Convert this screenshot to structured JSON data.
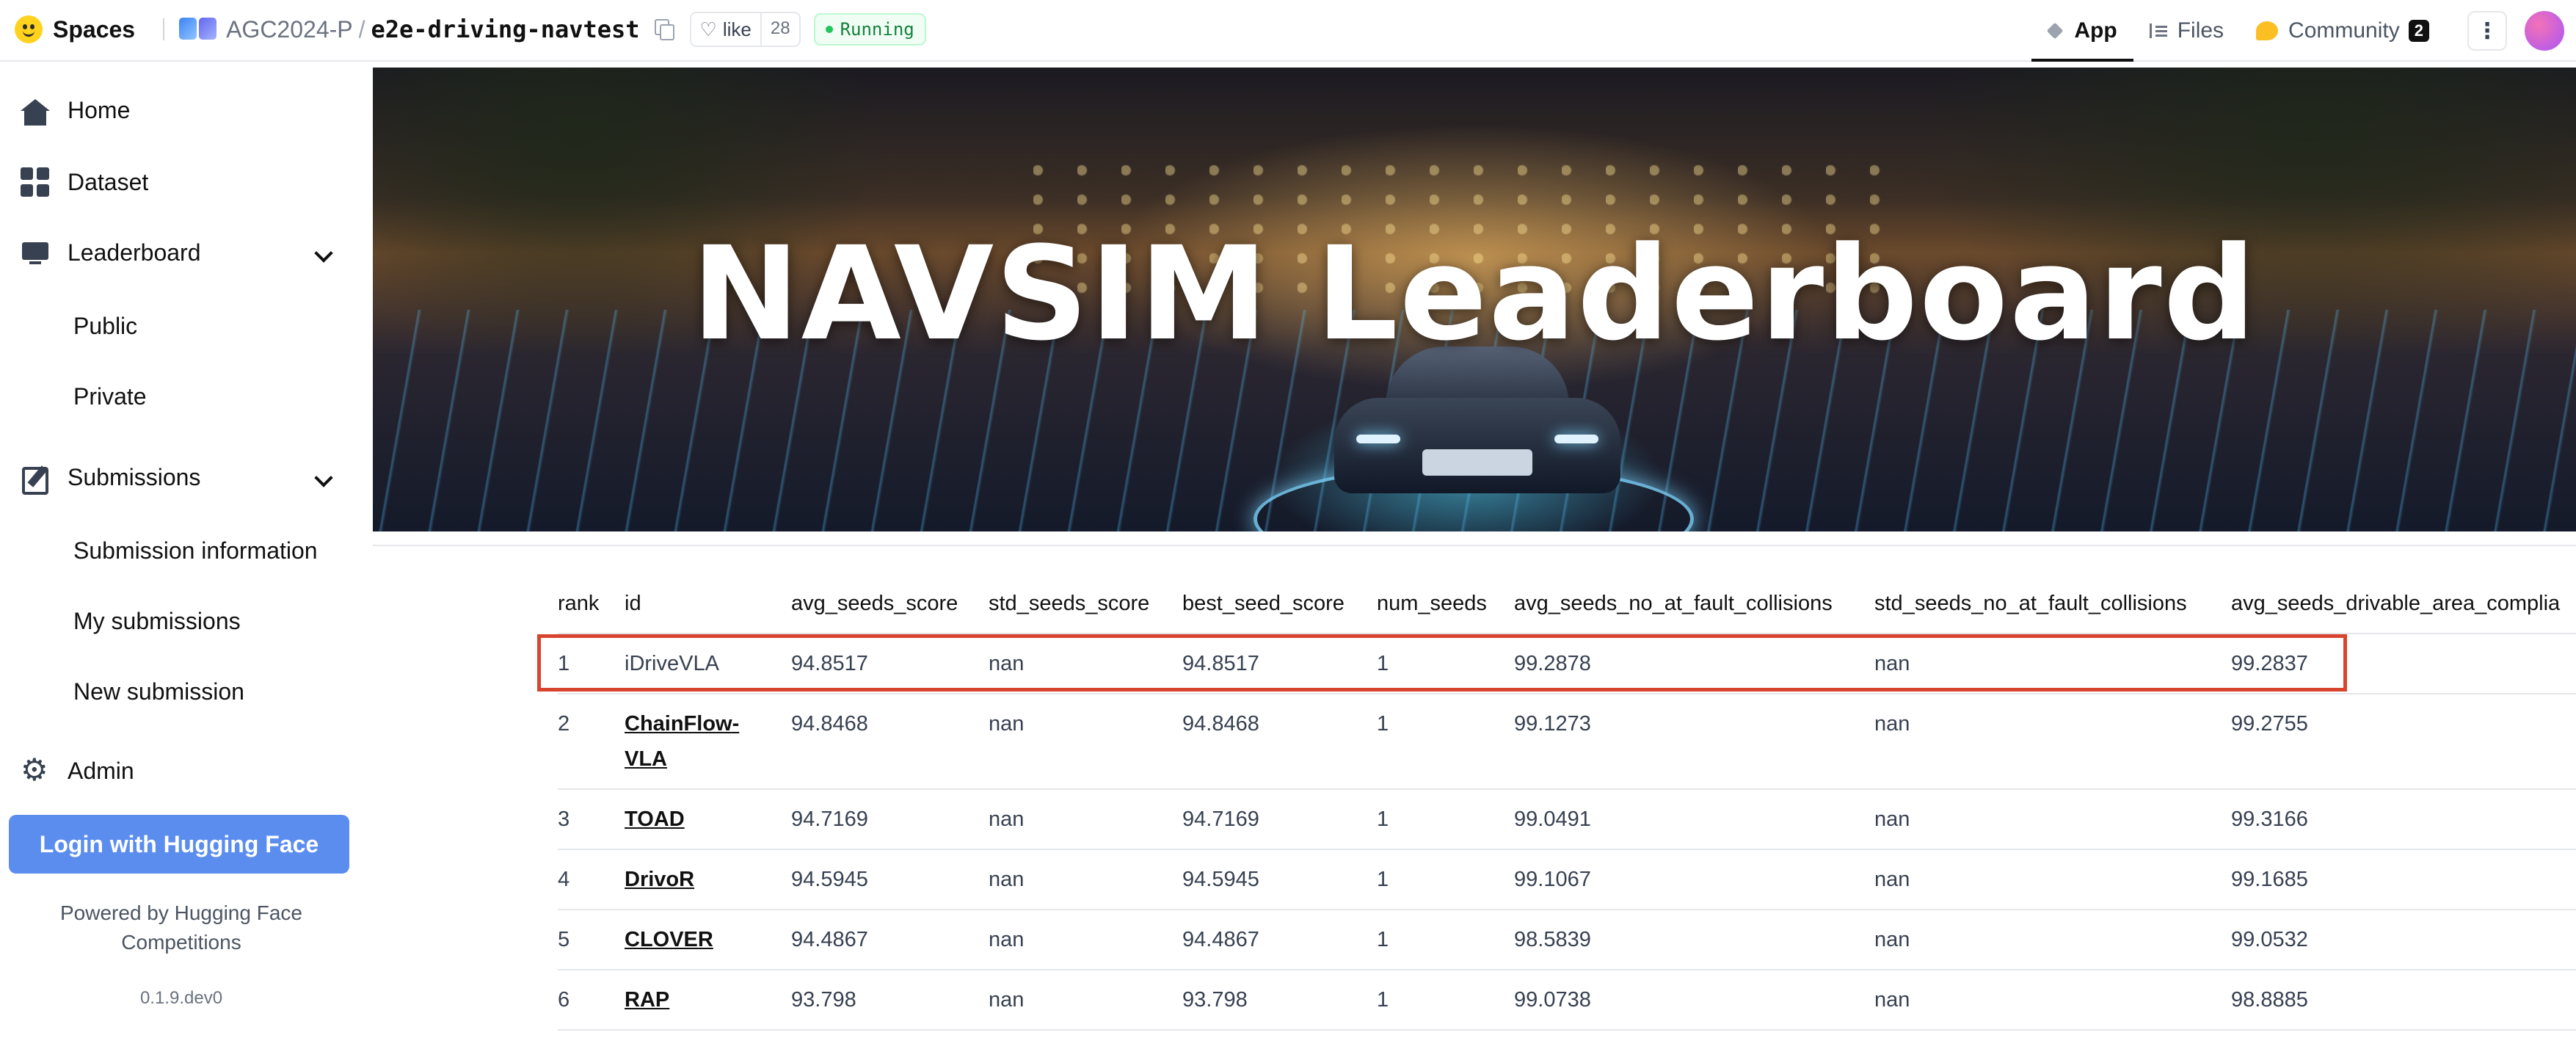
{
  "topbar": {
    "brand": "Spaces",
    "org": "AGC2024-P",
    "separator": "/",
    "repo": "e2e-driving-navtest",
    "like_label": "like",
    "like_count": "28",
    "status": "Running",
    "tabs": [
      {
        "label": "App",
        "icon": "cube-icon",
        "active": true
      },
      {
        "label": "Files",
        "icon": "files-icon",
        "active": false
      },
      {
        "label": "Community",
        "icon": "community-icon",
        "active": false,
        "badge": "2"
      }
    ],
    "menu_glyph": "⋮"
  },
  "sidebar": {
    "items": [
      {
        "label": "Home",
        "icon": "home-icon"
      },
      {
        "label": "Dataset",
        "icon": "dataset-icon"
      },
      {
        "label": "Leaderboard",
        "icon": "leaderboard-icon",
        "expandable": true
      },
      {
        "label": "Public"
      },
      {
        "label": "Private"
      },
      {
        "label": "Submissions",
        "icon": "submissions-icon",
        "expandable": true
      },
      {
        "label": "Submission information"
      },
      {
        "label": "My submissions"
      },
      {
        "label": "New submission"
      },
      {
        "label": "Admin",
        "icon": "gear-icon"
      }
    ],
    "login_button": "Login with Hugging Face",
    "powered_by_line1": "Powered by Hugging Face",
    "powered_by_line2": "Competitions",
    "version": "0.1.9.dev0"
  },
  "banner": {
    "title": "NAVSIM Leaderboard"
  },
  "table": {
    "columns": [
      "rank",
      "id",
      "avg_seeds_score",
      "std_seeds_score",
      "best_seed_score",
      "num_seeds",
      "avg_seeds_no_at_fault_collisions",
      "std_seeds_no_at_fault_collisions",
      "avg_seeds_drivable_area_complia"
    ],
    "rows": [
      {
        "rank": "1",
        "id": "iDriveVLA",
        "id_line2": "",
        "avg": "94.8517",
        "std": "nan",
        "best": "94.8517",
        "num": "1",
        "nafc_avg": "99.2878",
        "nafc_std": "nan",
        "dac_avg": "99.2837",
        "highlighted": true
      },
      {
        "rank": "2",
        "id": "ChainFlow-",
        "id_line2": "VLA",
        "avg": "94.8468",
        "std": "nan",
        "best": "94.8468",
        "num": "1",
        "nafc_avg": "99.1273",
        "nafc_std": "nan",
        "dac_avg": "99.2755"
      },
      {
        "rank": "3",
        "id": "TOAD",
        "id_line2": "",
        "avg": "94.7169",
        "std": "nan",
        "best": "94.7169",
        "num": "1",
        "nafc_avg": "99.0491",
        "nafc_std": "nan",
        "dac_avg": "99.3166"
      },
      {
        "rank": "4",
        "id": "DrivoR",
        "id_line2": "",
        "avg": "94.5945",
        "std": "nan",
        "best": "94.5945",
        "num": "1",
        "nafc_avg": "99.1067",
        "nafc_std": "nan",
        "dac_avg": "99.1685"
      },
      {
        "rank": "5",
        "id": "CLOVER",
        "id_line2": "",
        "avg": "94.4867",
        "std": "nan",
        "best": "94.4867",
        "num": "1",
        "nafc_avg": "98.5839",
        "nafc_std": "nan",
        "dac_avg": "99.0532"
      },
      {
        "rank": "6",
        "id": "RAP",
        "id_line2": "",
        "avg": "93.798",
        "std": "nan",
        "best": "93.798",
        "num": "1",
        "nafc_avg": "99.0738",
        "nafc_std": "nan",
        "dac_avg": "98.8885"
      }
    ]
  },
  "colors": {
    "accent_login": "#5b8def",
    "highlight_border": "#d9442f",
    "status_green": "#15803d"
  }
}
